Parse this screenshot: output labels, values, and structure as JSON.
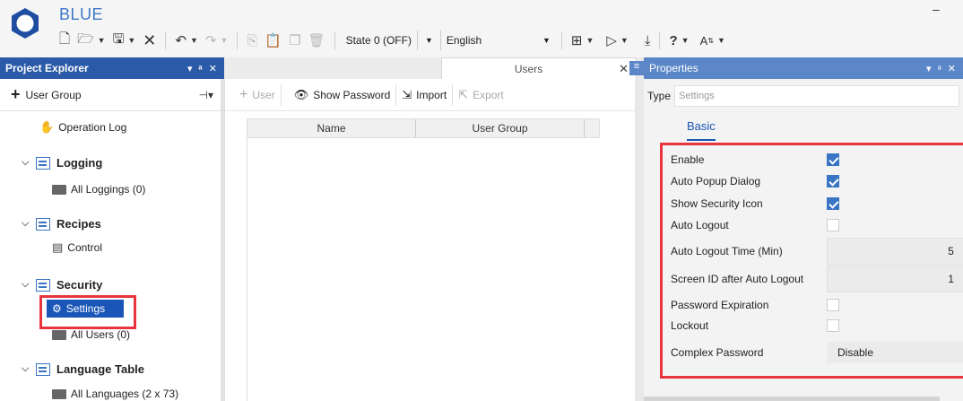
{
  "app": {
    "title": "BLUE",
    "minimize_glyph": "–"
  },
  "toolbar": {
    "state_value": "State 0 (OFF)",
    "language_value": "English",
    "help_glyph": "?",
    "icons": [
      "new-file-icon",
      "open-folder-icon",
      "save-icon",
      "close-x-icon",
      "undo-icon",
      "redo-icon",
      "copy-icon",
      "paste-icon",
      "duplicate-icon",
      "delete-icon",
      "layout-icon",
      "run-icon",
      "download-icon",
      "help-icon",
      "font-size-icon"
    ]
  },
  "project_explorer": {
    "title": "Project Explorer",
    "header_tools": "▾ ᵃ ✕",
    "add_group_label": "User Group",
    "tree": {
      "operation_log": "Operation Log",
      "logging": "Logging",
      "all_loggings": "All Loggings (0)",
      "recipes": "Recipes",
      "control": "Control",
      "security": "Security",
      "settings": "Settings",
      "all_users": "All Users (0)",
      "language_table": "Language Table",
      "all_languages": "All Languages (2 x 73)"
    }
  },
  "users_tab": {
    "label": "Users",
    "tools": {
      "user": "User",
      "show_password": "Show Password",
      "import": "Import",
      "export": "Export"
    },
    "columns": [
      "Name",
      "User Group"
    ]
  },
  "properties": {
    "title": "Properties",
    "header_tools": "▾ ᵃ ✕",
    "type_label": "Type",
    "type_placeholder": "Settings",
    "tab_basic": "Basic",
    "rows": {
      "enable": {
        "label": "Enable",
        "checked": true
      },
      "auto_popup": {
        "label": "Auto Popup Dialog",
        "checked": true
      },
      "show_security_icon": {
        "label": "Show Security Icon",
        "checked": true
      },
      "auto_logout": {
        "label": "Auto Logout",
        "checked": false
      },
      "auto_logout_time": {
        "label": "Auto Logout Time (Min)",
        "value": "5"
      },
      "screen_id": {
        "label": "Screen ID after Auto Logout",
        "value": "1"
      },
      "password_expiration": {
        "label": "Password Expiration",
        "checked": false
      },
      "lockout": {
        "label": "Lockout",
        "checked": false
      },
      "complex_password": {
        "label": "Complex Password",
        "value": "Disable"
      }
    }
  },
  "colors": {
    "accent": "#1a56b8",
    "highlight": "#e8343c",
    "panel_header": "#2a5aa8"
  }
}
